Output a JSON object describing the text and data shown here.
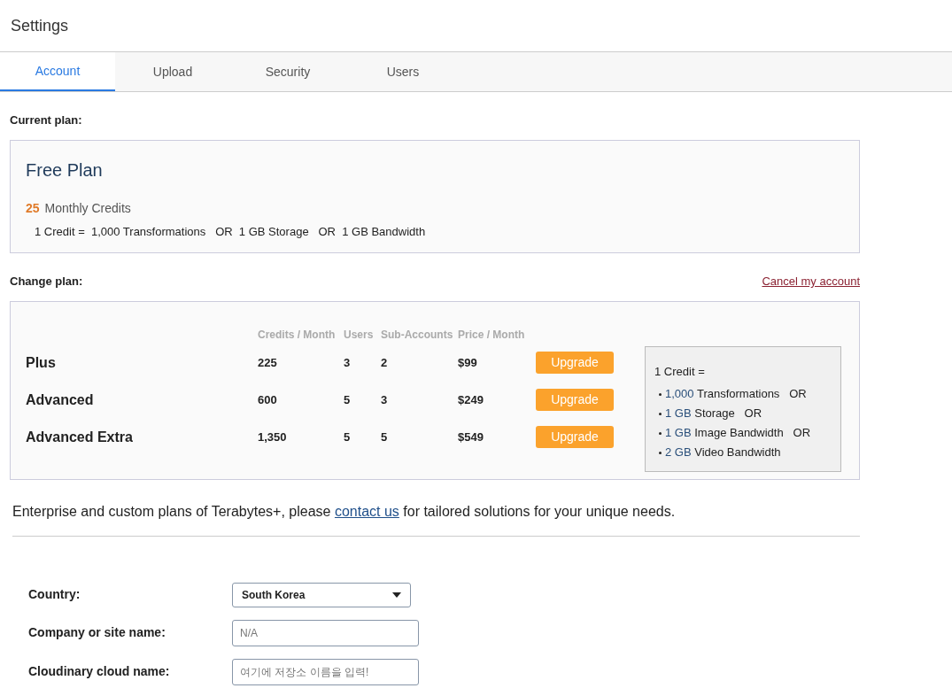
{
  "page_title": "Settings",
  "tabs": [
    {
      "label": "Account",
      "selected": true
    },
    {
      "label": "Upload",
      "selected": false
    },
    {
      "label": "Security",
      "selected": false
    },
    {
      "label": "Users",
      "selected": false
    }
  ],
  "current_plan": {
    "heading": "Current plan:",
    "name": "Free Plan",
    "credits": "25",
    "credits_label": "Monthly Credits",
    "credit_equation": "1 Credit =  1,000 Transformations   OR  1 GB Storage   OR  1 GB Bandwidth"
  },
  "change_plan": {
    "heading": "Change plan:",
    "cancel_link": "Cancel my account",
    "columns": [
      "Credits / Month",
      "Users",
      "Sub-Accounts",
      "Price / Month"
    ],
    "plans": [
      {
        "name": "Plus",
        "credits": "225",
        "users": "3",
        "sub_accounts": "2",
        "price": "$99",
        "button": "Upgrade"
      },
      {
        "name": "Advanced",
        "credits": "600",
        "users": "5",
        "sub_accounts": "3",
        "price": "$249",
        "button": "Upgrade"
      },
      {
        "name": "Advanced Extra",
        "credits": "1,350",
        "users": "5",
        "sub_accounts": "5",
        "price": "$549",
        "button": "Upgrade"
      }
    ],
    "legend": {
      "title": "1 Credit =",
      "items": [
        {
          "amount": "1,000",
          "label": "Transformations",
          "connector": "OR"
        },
        {
          "amount": "1 GB",
          "label": "Storage",
          "connector": "OR"
        },
        {
          "amount": "1 GB",
          "label": "Image Bandwidth",
          "connector": "OR"
        },
        {
          "amount": "2 GB",
          "label": "Video Bandwidth"
        }
      ]
    }
  },
  "enterprise": {
    "before": "Enterprise and custom plans of Terabytes+, please",
    "link": "contact us",
    "after": "for tailored solutions for your unique needs."
  },
  "form": [
    {
      "kind": "select",
      "label": "Country:",
      "value": "South Korea"
    },
    {
      "kind": "text",
      "label": "Company or site name:",
      "placeholder": "N/A"
    },
    {
      "kind": "text",
      "label": "Cloudinary cloud name:",
      "placeholder": "여기에 저장소 이름을 입력!"
    }
  ]
}
